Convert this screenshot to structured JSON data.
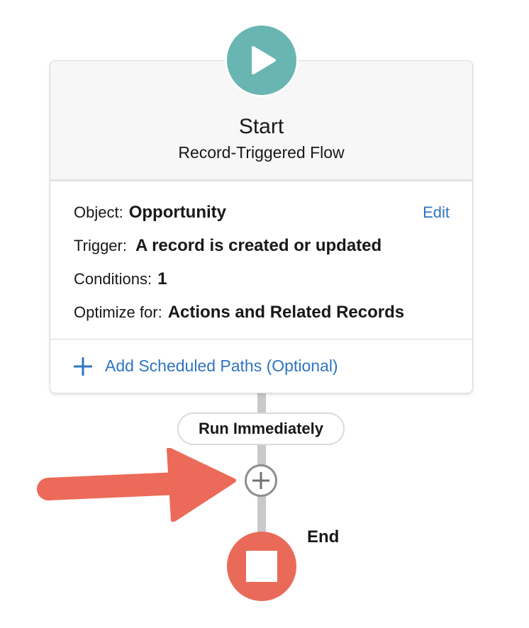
{
  "start": {
    "title": "Start",
    "subtitle": "Record-Triggered Flow",
    "icon": "play-icon",
    "color": "#69b5b2"
  },
  "details": {
    "edit_label": "Edit",
    "rows": [
      {
        "label": "Object:",
        "value": "Opportunity"
      },
      {
        "label": "Trigger:",
        "value": "A record is created or updated"
      },
      {
        "label": "Conditions:",
        "value": "1"
      },
      {
        "label": "Optimize for:",
        "value": "Actions and Related Records"
      }
    ],
    "add_scheduled_paths": "Add Scheduled Paths (Optional)"
  },
  "path": {
    "label": "Run Immediately",
    "add_icon": "plus-circle-icon"
  },
  "end": {
    "label": "End",
    "icon": "stop-icon",
    "color": "#ea6a5a"
  },
  "annotation": {
    "icon": "arrow-right-icon",
    "color": "#ec6a59"
  }
}
